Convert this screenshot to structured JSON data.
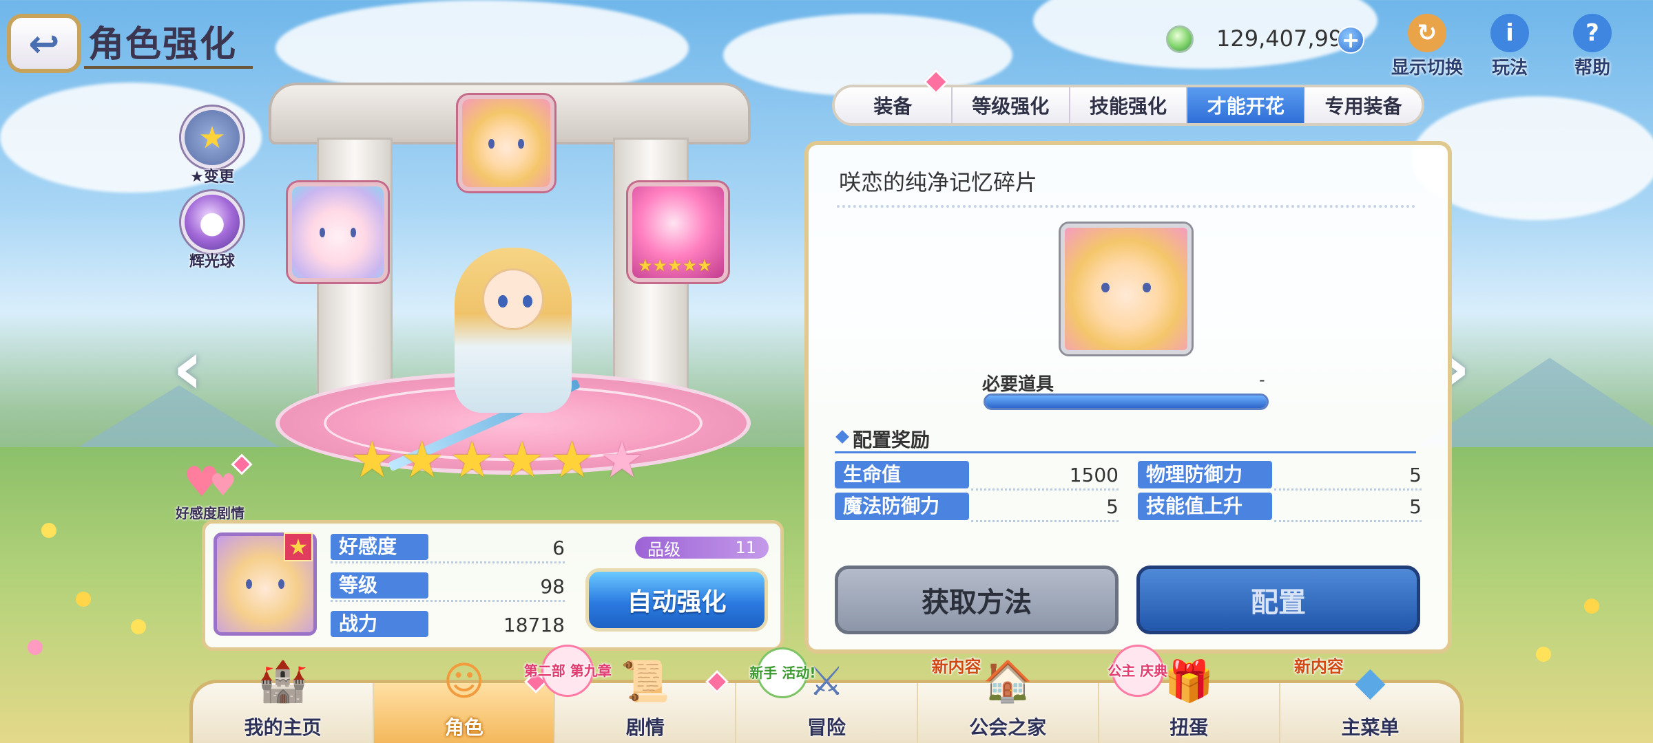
{
  "header": {
    "back_icon": "back-arrow-icon",
    "title": "角色强化"
  },
  "currency": {
    "icon": "gem-icon",
    "value": "129,407,999",
    "add_icon": "plus-icon"
  },
  "top_buttons": [
    {
      "label": "显示切换",
      "icon": "display-switch-icon"
    },
    {
      "label": "玩法",
      "icon": "info-icon"
    },
    {
      "label": "帮助",
      "icon": "help-icon"
    }
  ],
  "side_buttons": [
    {
      "label": "★变更",
      "icon": "star-change-icon"
    },
    {
      "label": "辉光球",
      "icon": "glow-orb-icon"
    }
  ],
  "character": {
    "stars_filled": 5,
    "stars_total": 6,
    "affection_label": "好感度剧情"
  },
  "status": {
    "rows": [
      {
        "label": "好感度",
        "value": "6"
      },
      {
        "label": "等级",
        "value": "98"
      },
      {
        "label": "战力",
        "value": "18718"
      }
    ],
    "grade_label": "品级",
    "grade_value": "11",
    "auto_button": "自动强化"
  },
  "tabs": [
    {
      "label": "装备",
      "active": false
    },
    {
      "label": "等级强化",
      "active": false
    },
    {
      "label": "技能强化",
      "active": false
    },
    {
      "label": "才能开花",
      "active": true
    },
    {
      "label": "专用装备",
      "active": false
    }
  ],
  "talent": {
    "item_name": "咲恋的纯净记忆碎片",
    "required_label": "必要道具",
    "required_value": "-",
    "required_progress": 1.0,
    "reward_title": "配置奖励",
    "bonuses": [
      {
        "label": "生命值",
        "value": "1500"
      },
      {
        "label": "物理防御力",
        "value": "5"
      },
      {
        "label": "魔法防御力",
        "value": "5"
      },
      {
        "label": "技能值上升",
        "value": "5"
      }
    ],
    "obtain_button": "获取方法",
    "equip_button": "配置"
  },
  "bottom_nav": [
    {
      "label": "我的主页",
      "icon": "castle-icon",
      "badge": "",
      "active": false
    },
    {
      "label": "角色",
      "icon": "character-icon",
      "badge": "",
      "active": true
    },
    {
      "label": "剧情",
      "icon": "scroll-icon",
      "badge": "第二部 第九章",
      "active": false
    },
    {
      "label": "冒险",
      "icon": "sword-icon",
      "badge": "新手 活动!",
      "active": false
    },
    {
      "label": "公会之家",
      "icon": "house-icon",
      "badge": "新内容",
      "active": false
    },
    {
      "label": "扭蛋",
      "icon": "gacha-icon",
      "badge": "公主 庆典",
      "active": false
    },
    {
      "label": "主菜单",
      "icon": "crystal-icon",
      "badge": "新内容",
      "active": false
    }
  ],
  "colors": {
    "accent_blue": "#4b83e0",
    "gold_border": "#e0c98f",
    "pink_badge": "#ff6fa0",
    "grade_purple": "#9c63d6"
  }
}
